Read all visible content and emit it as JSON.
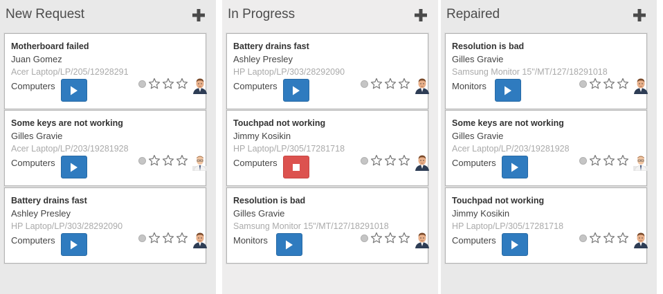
{
  "columns": [
    {
      "title": "New Request",
      "cards": [
        {
          "title": "Motherboard failed",
          "person": "Juan Gomez",
          "ref": "Acer Laptop/LP/205/12928291",
          "category": "Computers",
          "action": "play",
          "avatar": "avatar-man"
        },
        {
          "title": "Some keys are not working",
          "person": "Gilles Gravie",
          "ref": "Acer Laptop/LP/203/19281928",
          "category": "Computers",
          "action": "play",
          "avatar": "avatar-man-glasses"
        },
        {
          "title": "Battery drains fast",
          "person": "Ashley Presley",
          "ref": "HP Laptop/LP/303/28292090",
          "category": "Computers",
          "action": "play",
          "avatar": "avatar-man"
        }
      ]
    },
    {
      "title": "In Progress",
      "cards": [
        {
          "title": "Battery drains fast",
          "person": "Ashley Presley",
          "ref": "HP Laptop/LP/303/28292090",
          "category": "Computers",
          "action": "play",
          "avatar": "avatar-man"
        },
        {
          "title": "Touchpad not working",
          "person": "Jimmy Kosikin",
          "ref": "HP Laptop/LP/305/17281718",
          "category": "Computers",
          "action": "stop",
          "avatar": "avatar-man"
        },
        {
          "title": "Resolution is bad",
          "person": "Gilles Gravie",
          "ref": "Samsung Monitor 15\"/MT/127/18291018",
          "category": "Monitors",
          "action": "play",
          "avatar": "avatar-man"
        }
      ]
    },
    {
      "title": "Repaired",
      "cards": [
        {
          "title": "Resolution is bad",
          "person": "Gilles Gravie",
          "ref": "Samsung Monitor 15\"/MT/127/18291018",
          "category": "Monitors",
          "action": "play",
          "avatar": "avatar-man"
        },
        {
          "title": "Some keys are not working",
          "person": "Gilles Gravie",
          "ref": "Acer Laptop/LP/203/19281928",
          "category": "Computers",
          "action": "play",
          "avatar": "avatar-man-glasses"
        },
        {
          "title": "Touchpad not working",
          "person": "Jimmy Kosikin",
          "ref": "HP Laptop/LP/305/17281718",
          "category": "Computers",
          "action": "play",
          "avatar": "avatar-man"
        }
      ]
    }
  ],
  "icons": {
    "add": "plus-icon",
    "play": "play-icon",
    "stop": "stop-icon",
    "star": "star-outline-icon",
    "status": "status-dot-icon"
  },
  "colors": {
    "play": "#2f7bbf",
    "stop": "#dc524f",
    "column_bg": "#e9e9e9",
    "title_text": "#4c4c4c",
    "ref_text": "#aaaaaa"
  },
  "rating": {
    "stars": 3,
    "filled": 0
  }
}
